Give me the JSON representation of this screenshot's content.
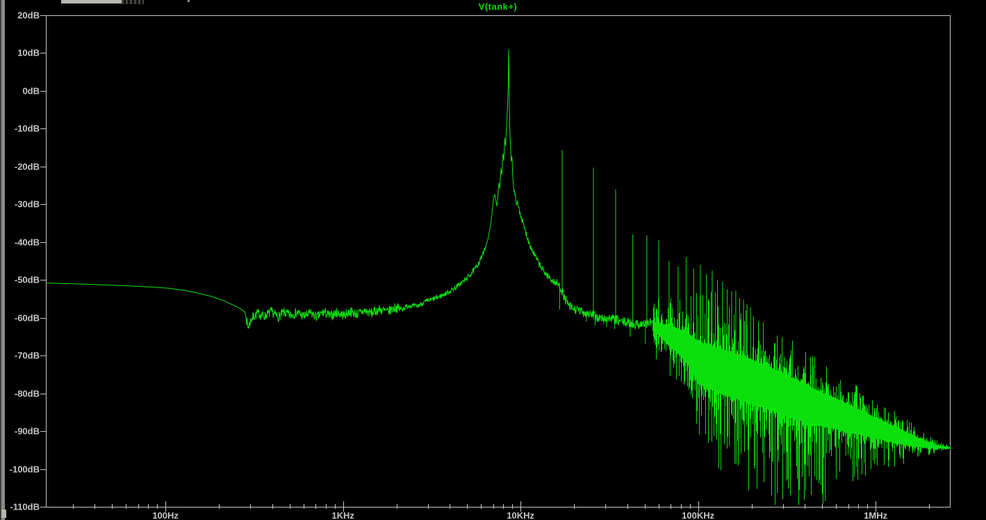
{
  "window": {
    "pane_type": "waveform-plot",
    "trace_label": "V(tank+)"
  },
  "chart_data": {
    "type": "line",
    "title": "V(tank+)",
    "background": "#000000",
    "axis_color": "#c8c8c8",
    "trace_color": "#0ce00c",
    "seed": 7,
    "x_axis": {
      "scale": "log",
      "unit": "Hz",
      "fmin_hz": 21.2,
      "fmax_hz": 2620000,
      "major_ticks": [
        {
          "hz": 100,
          "label": "100Hz"
        },
        {
          "hz": 1000,
          "label": "1KHz"
        },
        {
          "hz": 10000,
          "label": "10KHz"
        },
        {
          "hz": 100000,
          "label": "100KHz"
        },
        {
          "hz": 1000000,
          "label": "1MHz"
        }
      ]
    },
    "y_axis": {
      "unit": "dB",
      "max": 20,
      "min": -110,
      "step": 10,
      "labels": [
        "20dB",
        "10dB",
        "0dB",
        "-10dB",
        "-20dB",
        "-30dB",
        "-40dB",
        "-50dB",
        "-60dB",
        "-70dB",
        "-80dB",
        "-90dB",
        "-100dB",
        "-110dB"
      ]
    },
    "fundamental_peak": {
      "hz": 8580,
      "db": 13.2
    },
    "envelope_points": [
      [
        21,
        -50.8
      ],
      [
        30,
        -51.0
      ],
      [
        45,
        -51.3
      ],
      [
        65,
        -51.6
      ],
      [
        85,
        -51.9
      ],
      [
        105,
        -52.2
      ],
      [
        125,
        -52.7
      ],
      [
        150,
        -53.4
      ],
      [
        180,
        -54.3
      ],
      [
        215,
        -55.6
      ],
      [
        250,
        -57.0
      ],
      [
        280,
        -58.4
      ],
      [
        292,
        -62.6
      ],
      [
        305,
        -60.2
      ],
      [
        330,
        -58.8
      ],
      [
        360,
        -59.6
      ],
      [
        395,
        -58.4
      ],
      [
        430,
        -59.8
      ],
      [
        465,
        -58.6
      ],
      [
        505,
        -59.4
      ],
      [
        550,
        -58.6
      ],
      [
        600,
        -59.6
      ],
      [
        655,
        -58.8
      ],
      [
        715,
        -59.8
      ],
      [
        780,
        -58.5
      ],
      [
        850,
        -59.6
      ],
      [
        925,
        -58.6
      ],
      [
        1010,
        -59.3
      ],
      [
        1100,
        -58.4
      ],
      [
        1200,
        -59.0
      ],
      [
        1320,
        -58.2
      ],
      [
        1450,
        -58.8
      ],
      [
        1600,
        -57.8
      ],
      [
        1780,
        -58.4
      ],
      [
        1960,
        -57.3
      ],
      [
        2150,
        -57.7
      ],
      [
        2360,
        -56.7
      ],
      [
        2600,
        -57.0
      ],
      [
        2870,
        -55.9
      ],
      [
        3150,
        -55.2
      ],
      [
        3500,
        -54.4
      ],
      [
        3900,
        -53.3
      ],
      [
        4300,
        -52.0
      ],
      [
        4700,
        -50.6
      ],
      [
        5100,
        -49.1
      ],
      [
        5500,
        -47.3
      ],
      [
        5900,
        -45.0
      ],
      [
        6250,
        -42.3
      ],
      [
        6550,
        -39.2
      ],
      [
        6800,
        -35.2
      ],
      [
        6950,
        -31.2
      ],
      [
        7050,
        -28.2
      ],
      [
        7150,
        -27.3
      ],
      [
        7250,
        -28.8
      ],
      [
        7350,
        -30.6
      ],
      [
        7450,
        -28.1
      ],
      [
        7550,
        -24.2
      ],
      [
        7650,
        -26.2
      ],
      [
        7750,
        -20.2
      ],
      [
        7850,
        -22.6
      ],
      [
        7950,
        -16.2
      ],
      [
        8050,
        -18.6
      ],
      [
        8150,
        -12.2
      ],
      [
        8250,
        -15.2
      ],
      [
        8350,
        -8.2
      ],
      [
        8450,
        -4.2
      ],
      [
        8530,
        1.8
      ],
      [
        8580,
        13.2
      ],
      [
        8640,
        -2.5
      ],
      [
        8700,
        -10.6
      ],
      [
        8780,
        -14.6
      ],
      [
        8860,
        -19.2
      ],
      [
        8950,
        -16.8
      ],
      [
        9060,
        -23.2
      ],
      [
        9200,
        -26.6
      ],
      [
        9400,
        -28.6
      ],
      [
        9700,
        -30.6
      ],
      [
        10000,
        -32.6
      ],
      [
        10400,
        -35.6
      ],
      [
        10900,
        -38.6
      ],
      [
        11500,
        -41.6
      ],
      [
        12200,
        -44.1
      ],
      [
        13000,
        -46.6
      ],
      [
        14000,
        -48.6
      ],
      [
        15200,
        -50.3
      ],
      [
        16300,
        -51.3
      ],
      [
        16900,
        -52.1
      ],
      [
        17600,
        -54.6
      ],
      [
        18500,
        -56.6
      ],
      [
        19600,
        -57.6
      ],
      [
        21000,
        -58.1
      ],
      [
        23000,
        -58.6
      ],
      [
        25000,
        -59.1
      ],
      [
        27000,
        -59.9
      ],
      [
        29500,
        -60.4
      ],
      [
        32000,
        -60.1
      ],
      [
        36000,
        -60.9
      ],
      [
        40000,
        -61.3
      ],
      [
        45000,
        -61.7
      ],
      [
        50000,
        -61.6
      ],
      [
        55000,
        -61.2
      ]
    ],
    "noise_segments": [
      [
        285,
        2100,
        1.3
      ],
      [
        2100,
        6400,
        0.7
      ],
      [
        9000,
        16000,
        0.9
      ],
      [
        16000,
        55000,
        1.3
      ]
    ],
    "harmonic_spikes": [
      [
        17160,
        -15.6
      ],
      [
        25740,
        -20.3
      ],
      [
        34320,
        -26.0
      ],
      [
        42900,
        -38.0
      ],
      [
        51480,
        -38.2
      ],
      [
        60060,
        -39.4
      ],
      [
        68640,
        -45.0
      ],
      [
        77220,
        -46.5
      ],
      [
        85800,
        -44.0
      ],
      [
        94380,
        -47.0
      ],
      [
        102960,
        -46.0
      ],
      [
        111540,
        -48.5
      ],
      [
        120120,
        -47.5
      ],
      [
        128700,
        -50.0
      ],
      [
        137280,
        -50.5
      ],
      [
        145860,
        -52.5
      ],
      [
        154440,
        -53.0
      ],
      [
        163020,
        -52.8
      ],
      [
        171600,
        -54.8
      ],
      [
        180180,
        -55.2
      ],
      [
        188760,
        -56.5
      ],
      [
        197340,
        -57.2
      ]
    ],
    "base_down_spikes": [
      [
        16600,
        -57.8
      ],
      [
        23500,
        -61.0
      ],
      [
        26300,
        -62.0
      ],
      [
        30500,
        -62.5
      ],
      [
        33800,
        -63.0
      ],
      [
        41500,
        -65.0
      ],
      [
        50500,
        -67.0
      ]
    ],
    "noise_band": {
      "anchors": [
        [
          55000,
          -62.0,
          1.5,
          5,
          6
        ],
        [
          70000,
          -65.0,
          4.0,
          7,
          9
        ],
        [
          85000,
          -67.5,
          5.5,
          8,
          11
        ],
        [
          100000,
          -72.0,
          8.0,
          11,
          13
        ],
        [
          140000,
          -74.5,
          8.5,
          11,
          17
        ],
        [
          190000,
          -76.5,
          8.5,
          8,
          22
        ],
        [
          260000,
          -79.0,
          8.0,
          7,
          26
        ],
        [
          350000,
          -81.5,
          7.5,
          6,
          26
        ],
        [
          480000,
          -84.0,
          6.5,
          5,
          19
        ],
        [
          650000,
          -86.0,
          5.5,
          4,
          13
        ],
        [
          850000,
          -88.0,
          4.5,
          3.5,
          9
        ],
        [
          1050000,
          -89.5,
          3.8,
          3,
          7
        ],
        [
          1300000,
          -91.0,
          3.0,
          2.5,
          5
        ],
        [
          1600000,
          -92.5,
          2.2,
          2,
          3.5
        ],
        [
          1950000,
          -93.6,
          1.2,
          1.5,
          2
        ],
        [
          2250000,
          -94.2,
          0.6,
          0.8,
          1
        ],
        [
          2620000,
          -94.4,
          0.25,
          0.4,
          0.5
        ]
      ],
      "deep_spikes": [
        [
          150000,
          -94
        ],
        [
          175000,
          -96
        ],
        [
          210000,
          -99
        ],
        [
          235000,
          -103.5
        ],
        [
          262000,
          -98
        ],
        [
          300000,
          -108
        ],
        [
          330000,
          -100
        ],
        [
          368000,
          -104.5
        ],
        [
          405000,
          -99
        ],
        [
          455000,
          -102
        ],
        [
          520000,
          -108.5
        ],
        [
          600000,
          -99
        ],
        [
          680000,
          -96.5
        ],
        [
          780000,
          -97
        ]
      ]
    }
  }
}
